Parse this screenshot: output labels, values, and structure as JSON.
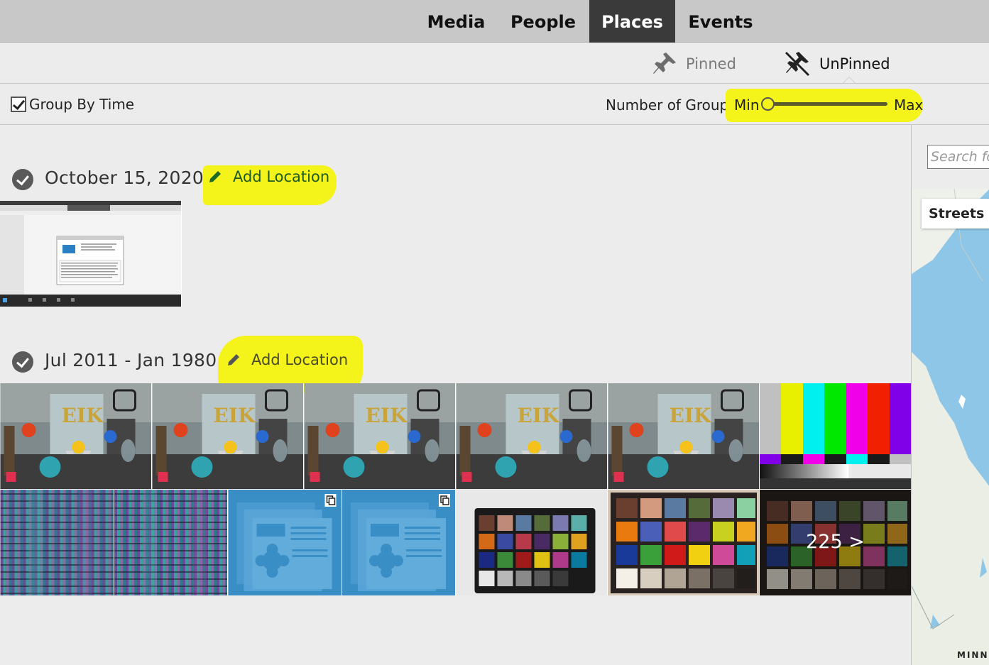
{
  "topbar": {
    "tabs": [
      {
        "label": "Media",
        "active": false
      },
      {
        "label": "People",
        "active": false
      },
      {
        "label": "Places",
        "active": true
      },
      {
        "label": "Events",
        "active": false
      }
    ]
  },
  "pin_filter": {
    "pinned_label": "Pinned",
    "unpinned_label": "UnPinned",
    "selected": "UnPinned"
  },
  "options": {
    "group_by_time_label": "Group By Time",
    "group_by_time_checked": true,
    "groups_label": "Number of Groups:",
    "slider_min_label": "Min",
    "slider_max_label": "Max",
    "slider_value": 0
  },
  "groups": [
    {
      "title": "October 15, 2020",
      "add_location_label": "Add Location",
      "thumbnails": [
        "screenshot"
      ]
    },
    {
      "title": "Jul 2011 - Jan 1980",
      "add_location_label": "Add Location",
      "thumbnails": [
        "still-life",
        "still-life",
        "still-life",
        "still-life",
        "still-life",
        "color-bars",
        "color-noise",
        "color-noise",
        "placeholder-stack",
        "placeholder-stack",
        "color-checker",
        "color-checker",
        "color-checker-more"
      ],
      "more_count_label": "225 >"
    }
  ],
  "map": {
    "search_placeholder": "Search fo",
    "layer_label": "Streets",
    "region_label": "MINN"
  },
  "colors": {
    "highlight": "#f4f41a",
    "active_tab": "#3a3a3a",
    "placeholder_blue": "#3a8ec6"
  }
}
